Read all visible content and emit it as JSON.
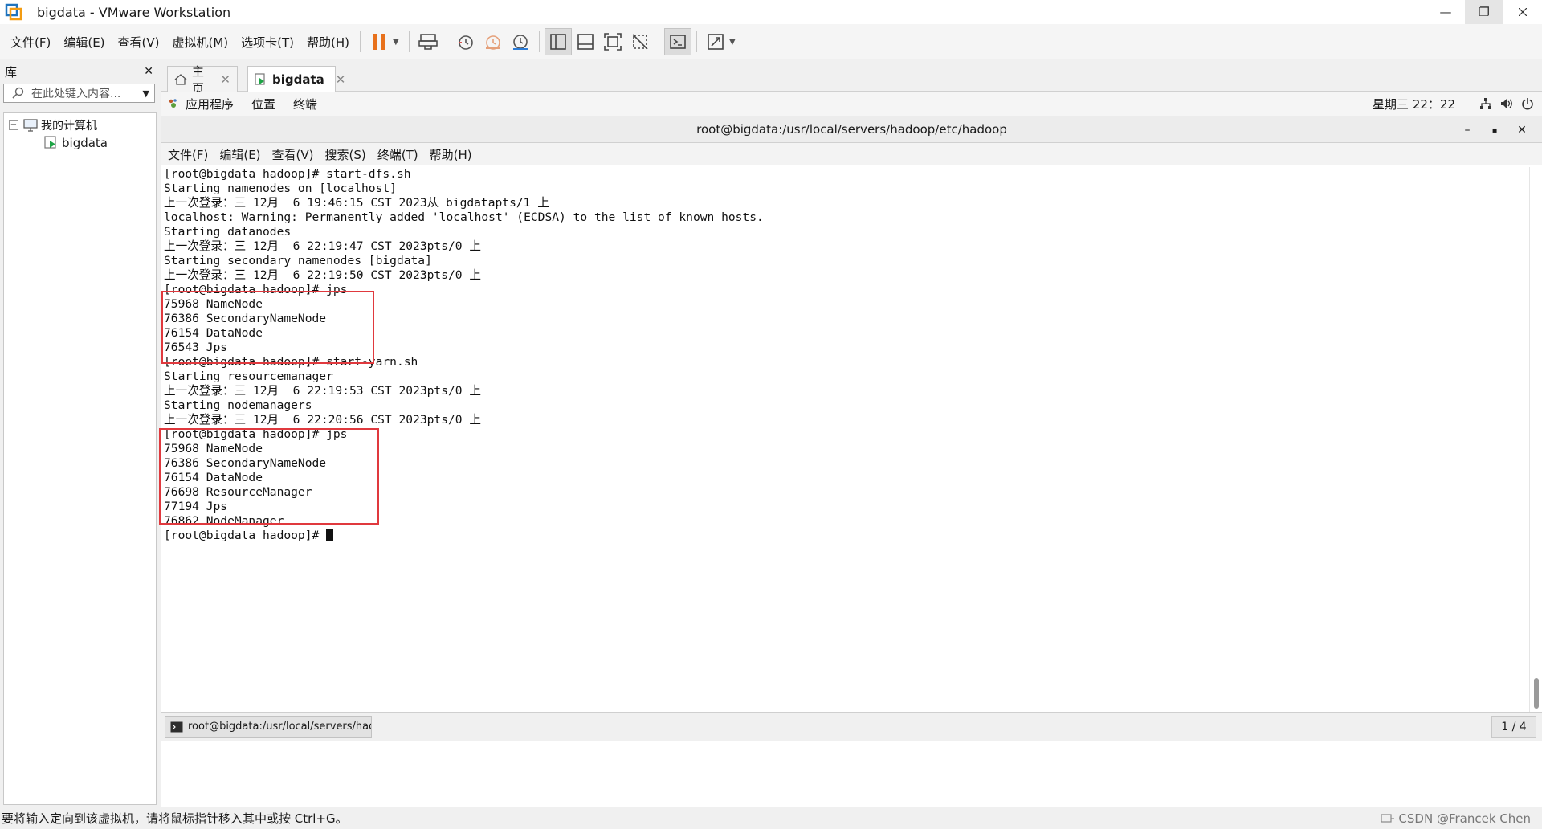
{
  "window": {
    "title": "bigdata - VMware Workstation",
    "controls": [
      "—",
      "❐",
      ""
    ]
  },
  "menu": [
    "文件(F)",
    "编辑(E)",
    "查看(V)",
    "虚拟机(M)",
    "选项卡(T)",
    "帮助(H)"
  ],
  "colors": {
    "pause_accent": "#e8711c",
    "highlight_box": "#e0393e",
    "power_green": "#1ea446"
  },
  "library": {
    "title": "库",
    "close": "✕",
    "search_placeholder": "在此处键入内容...",
    "tree": {
      "root": "我的计算机",
      "vm": "bigdata"
    }
  },
  "tabs": [
    {
      "label": "主页",
      "icon": "home-icon"
    },
    {
      "label": "bigdata",
      "icon": "vm-icon",
      "active": true
    }
  ],
  "gnome": {
    "apps": "应用程序",
    "places": "位置",
    "terminal": "终端",
    "clock": "星期三 22：22"
  },
  "terminal_window": {
    "title": "root@bigdata:/usr/local/servers/hadoop/etc/hadoop",
    "controls": [
      "–",
      "▪",
      "✕"
    ],
    "menu": [
      "文件(F)",
      "编辑(E)",
      "查看(V)",
      "搜索(S)",
      "终端(T)",
      "帮助(H)"
    ]
  },
  "terminal_lines": [
    "[root@bigdata hadoop]# start-dfs.sh",
    "Starting namenodes on [localhost]",
    "上一次登录：三 12月  6 19:46:15 CST 2023从 bigdatapts/1 上",
    "localhost: Warning: Permanently added 'localhost' (ECDSA) to the list of known hosts.",
    "Starting datanodes",
    "上一次登录：三 12月  6 22:19:47 CST 2023pts/0 上",
    "Starting secondary namenodes [bigdata]",
    "上一次登录：三 12月  6 22:19:50 CST 2023pts/0 上",
    "[root@bigdata hadoop]# jps",
    "75968 NameNode",
    "76386 SecondaryNameNode",
    "76154 DataNode",
    "76543 Jps",
    "[root@bigdata hadoop]# start-yarn.sh",
    "Starting resourcemanager",
    "上一次登录：三 12月  6 22:19:53 CST 2023pts/0 上",
    "Starting nodemanagers",
    "上一次登录：三 12月  6 22:20:56 CST 2023pts/0 上",
    "[root@bigdata hadoop]# jps",
    "75968 NameNode",
    "76386 SecondaryNameNode",
    "76154 DataNode",
    "76698 ResourceManager",
    "77194 Jps",
    "76862 NodeManager",
    "[root@bigdata hadoop]# "
  ],
  "taskbar": {
    "item": "root@bigdata:/usr/local/servers/had...",
    "pager": "1 / 4"
  },
  "statusbar": {
    "hint": "要将输入定向到该虚拟机，请将鼠标指针移入其中或按 Ctrl+G。",
    "watermark": "CSDN @Francek Chen"
  }
}
